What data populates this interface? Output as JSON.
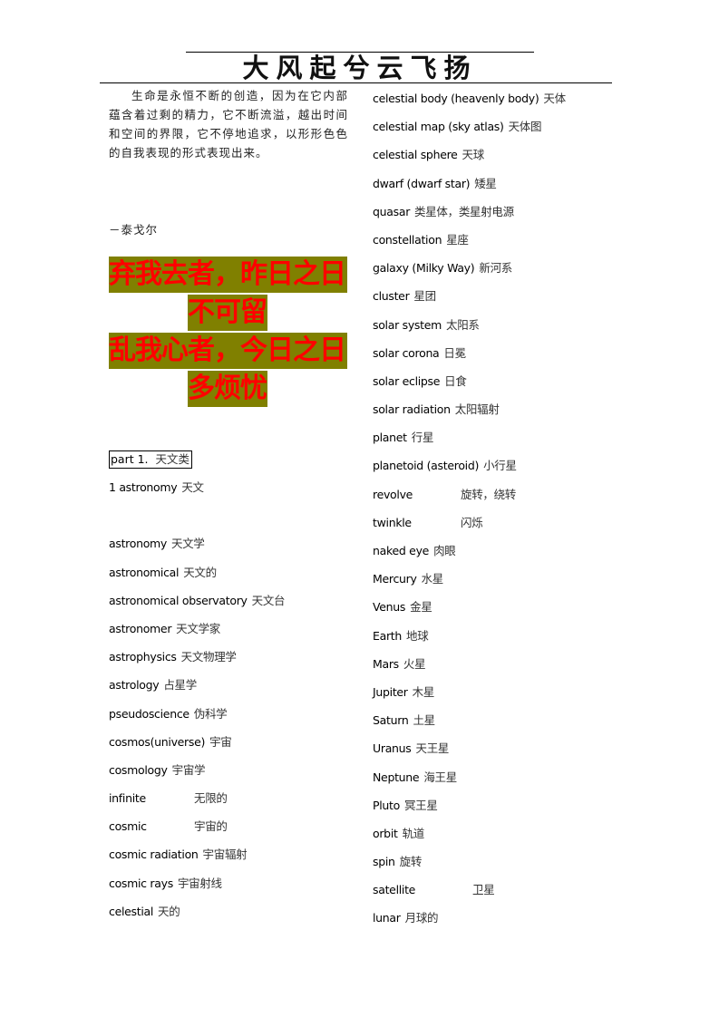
{
  "header": {
    "title": "大风起兮云飞扬"
  },
  "left_column": {
    "quote": "生命是永恒不断的创造，因为在它内部蕴含着过剩的精力，它不断流溢，越出时间和空间的界限，它不停地追求，以形形色色的自我表现的形式表现出来。",
    "attribution": "－泰戈尔",
    "poem": [
      "弃我去者，昨日之日",
      "不可留",
      "乱我心者，今日之日",
      "多烦忧"
    ],
    "highlight_bg": "#808000",
    "highlight_fg": "#FF0000",
    "part_heading": {
      "en": "part 1.",
      "zh": "天文类"
    },
    "entries": [
      {
        "en": "1 astronomy",
        "zh": "天文"
      },
      {
        "en": "astronomy",
        "zh": "天文学"
      },
      {
        "en": "astronomical",
        "zh": "天文的"
      },
      {
        "en": "astronomical observatory",
        "zh": "天文台"
      },
      {
        "en": "astronomer",
        "zh": "天文学家"
      },
      {
        "en": "astrophysics",
        "zh": "天文物理学"
      },
      {
        "en": "astrology",
        "zh": "占星学"
      },
      {
        "en": "pseudoscience",
        "zh": "伪科学"
      },
      {
        "en": "cosmos(universe)",
        "zh": "宇宙"
      },
      {
        "en": "cosmology",
        "zh": "宇宙学"
      },
      {
        "en": "infinite",
        "zh": "无限的"
      },
      {
        "en": "cosmic",
        "zh": "宇宙的"
      },
      {
        "en": "cosmic radiation",
        "zh": "宇宙辐射"
      },
      {
        "en": "cosmic rays",
        "zh": "宇宙射线"
      },
      {
        "en": "celestial",
        "zh": "天的"
      }
    ]
  },
  "right_column": {
    "entries": [
      {
        "en": "celestial body (heavenly body)",
        "zh": "天体"
      },
      {
        "en": "celestial map (sky atlas)",
        "zh": "天体图"
      },
      {
        "en": "celestial sphere",
        "zh": "天球"
      },
      {
        "en": "dwarf (dwarf star)",
        "zh": "矮星"
      },
      {
        "en": "quasar",
        "zh": "类星体，类星射电源"
      },
      {
        "en": "constellation",
        "zh": "星座"
      },
      {
        "en": "galaxy (Milky Way)",
        "zh": "新河系"
      },
      {
        "en": "cluster",
        "zh": "星团"
      },
      {
        "en": "solar system",
        "zh": "太阳系"
      },
      {
        "en": "solar corona",
        "zh": "日冕"
      },
      {
        "en": "solar eclipse",
        "zh": "日食"
      },
      {
        "en": "solar radiation",
        "zh": "太阳辐射"
      },
      {
        "en": "planet",
        "zh": "行星"
      },
      {
        "en": "planetoid (asteroid)",
        "zh": "小行星"
      },
      {
        "en": "revolve",
        "zh": "旋转，绕转"
      },
      {
        "en": "twinkle",
        "zh": "闪烁"
      },
      {
        "en": "naked eye",
        "zh": "肉眼"
      },
      {
        "en": "Mercury",
        "zh": "水星"
      },
      {
        "en": "Venus",
        "zh": "金星"
      },
      {
        "en": "Earth",
        "zh": "地球"
      },
      {
        "en": "Mars",
        "zh": "火星"
      },
      {
        "en": "Jupiter",
        "zh": "木星"
      },
      {
        "en": "Saturn",
        "zh": "土星"
      },
      {
        "en": "Uranus",
        "zh": "天王星"
      },
      {
        "en": "Neptune",
        "zh": "海王星"
      },
      {
        "en": "Pluto",
        "zh": "冥王星"
      },
      {
        "en": "orbit",
        "zh": "轨道"
      },
      {
        "en": "spin",
        "zh": "旋转"
      },
      {
        "en": "satellite",
        "zh": "卫星"
      },
      {
        "en": "lunar",
        "zh": "月球的"
      }
    ]
  }
}
